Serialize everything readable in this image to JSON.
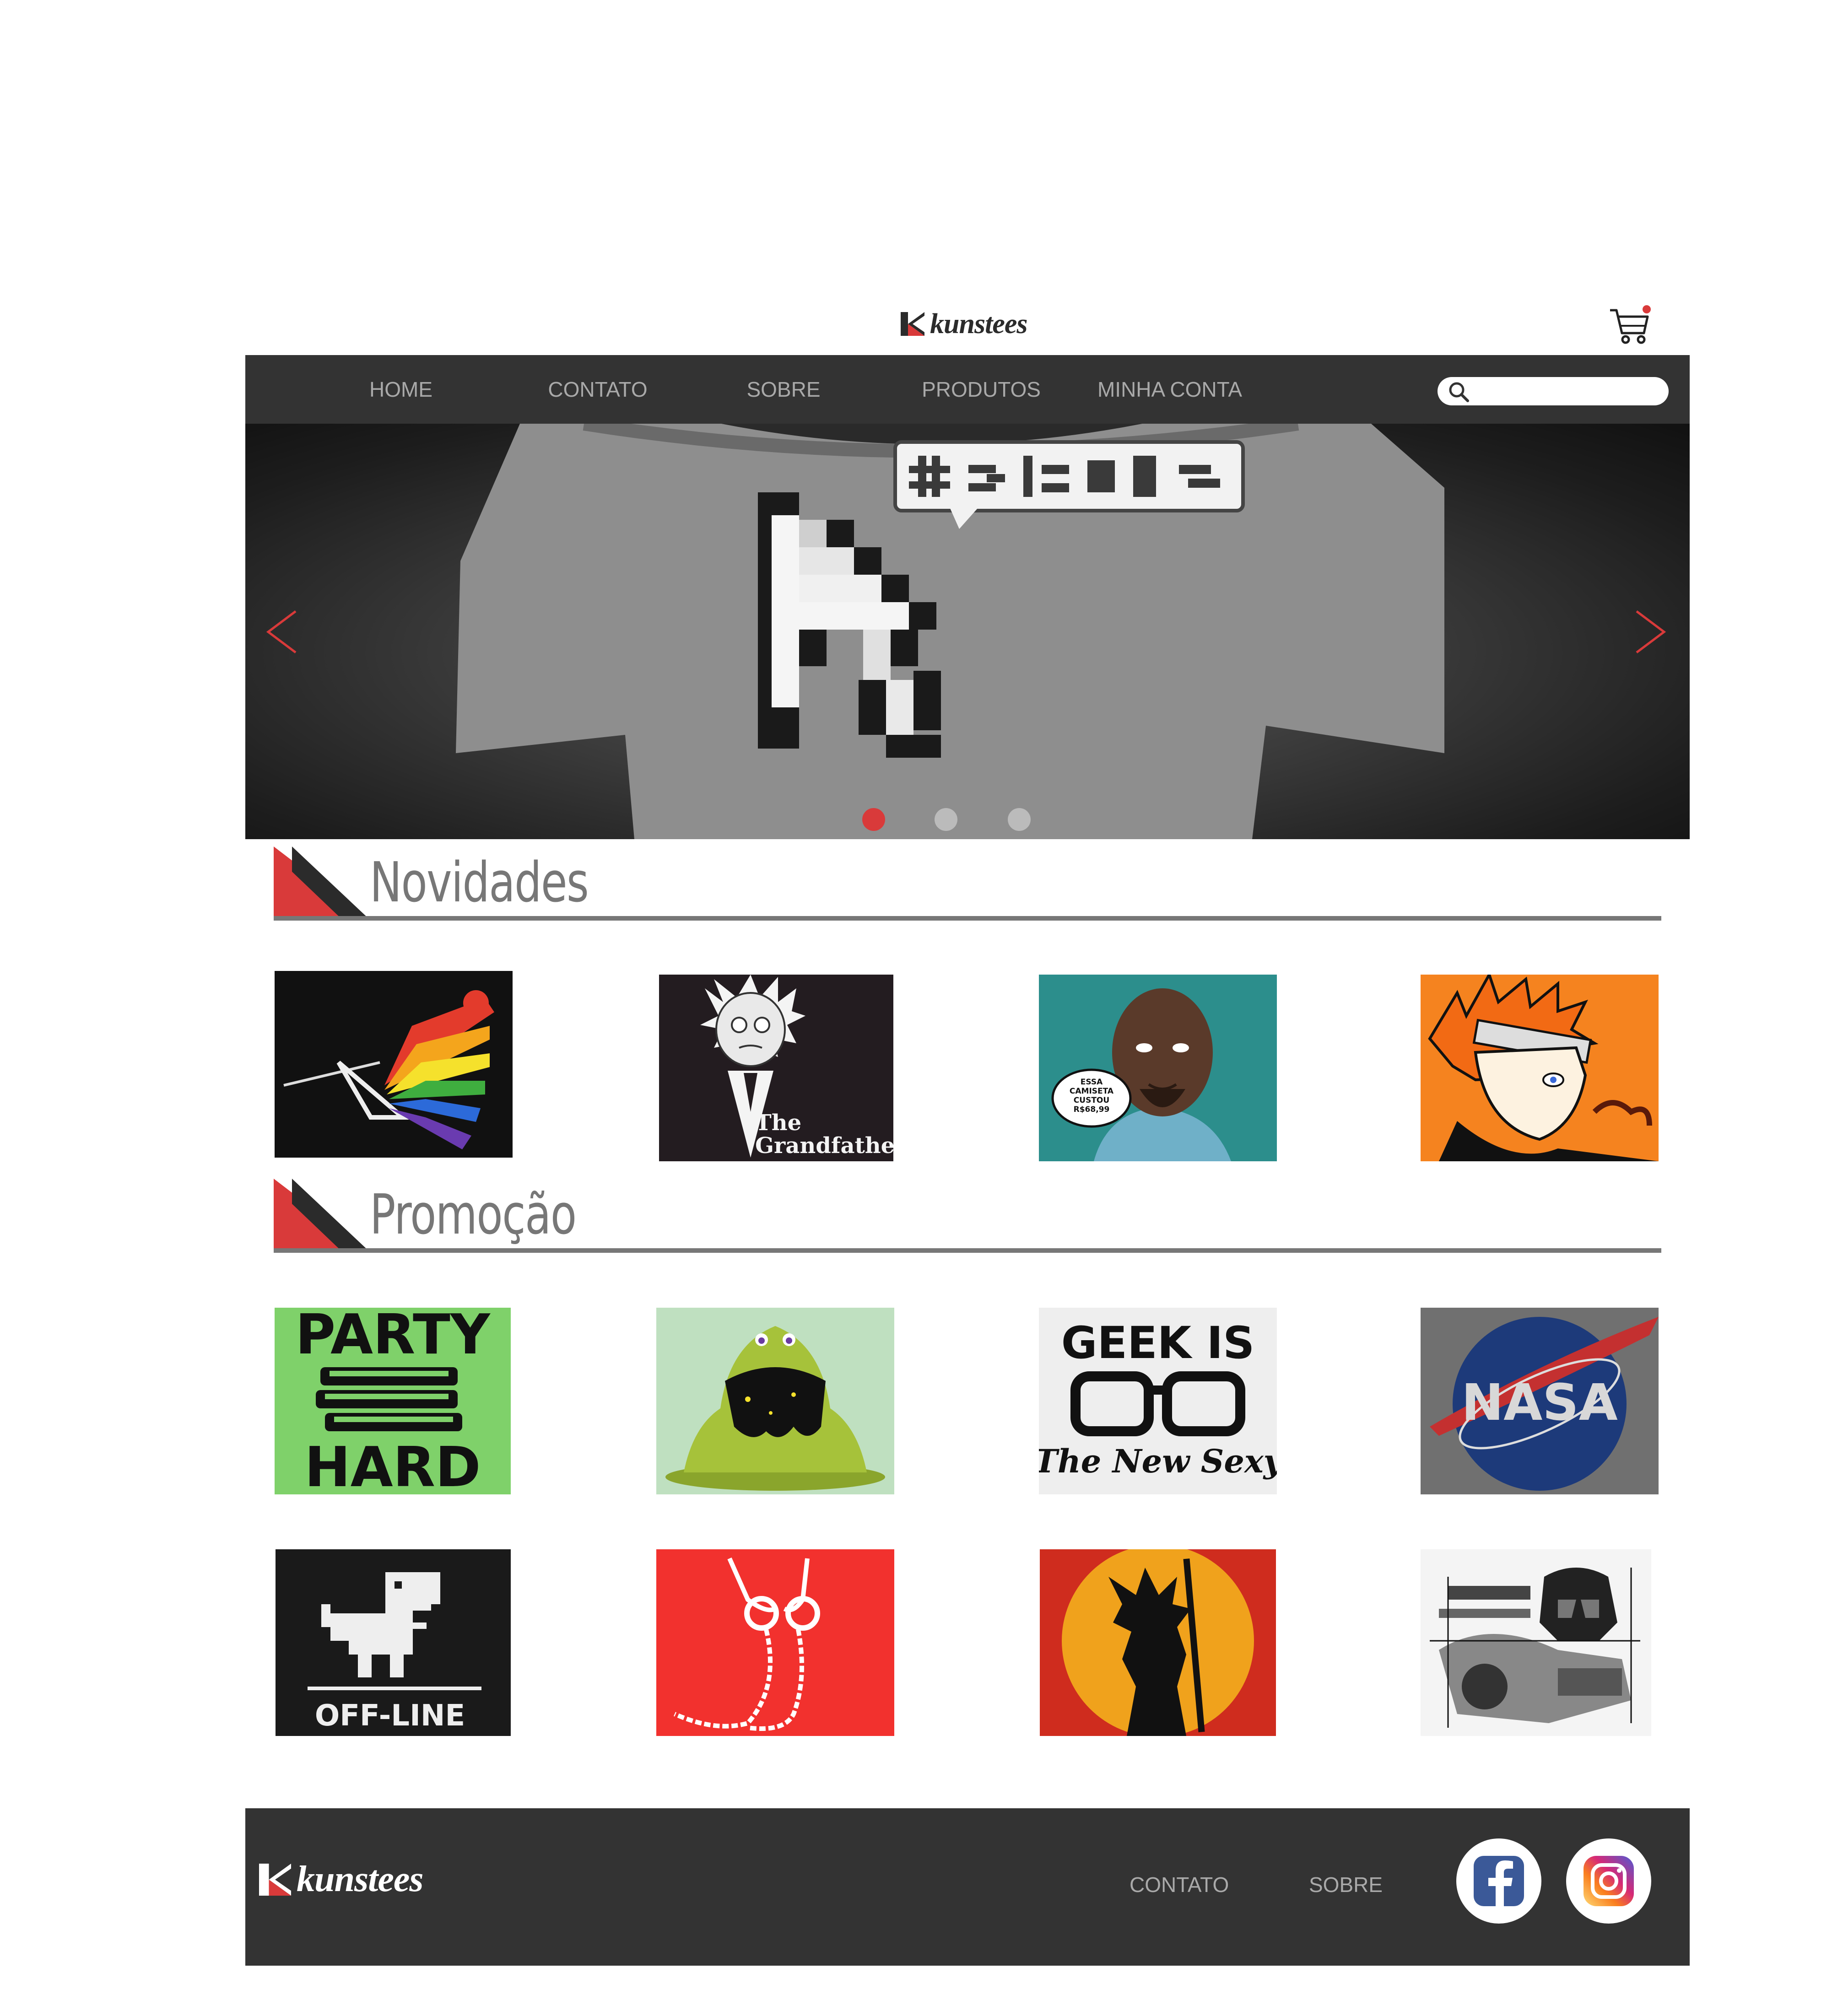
{
  "header": {
    "brand": "kunstees",
    "cart_icon": "shopping-cart-icon"
  },
  "nav": {
    "items": [
      "HOME",
      "CONTATO",
      "SOBRE",
      "PRODUTOS",
      "MINHA CONTA"
    ],
    "search_placeholder": "",
    "search_icon": "search-icon"
  },
  "carousel": {
    "slide_count": 3,
    "active_slide": 1,
    "prev_icon": "chevron-left-icon",
    "next_icon": "chevron-right-icon"
  },
  "sections": {
    "novidades": {
      "title": "Novidades",
      "products": [
        "prism-rainbow-shirt",
        "grandfather-shirt",
        "price-comic-shirt",
        "orange-ninja-shirt"
      ],
      "product_texts": {
        "grandfather": [
          "The",
          "Grandfather"
        ],
        "price_bubble": [
          "ESSA",
          "CAMISETA",
          "CUSTOU",
          "R$68,99"
        ]
      }
    },
    "promocao": {
      "title": "Promoção",
      "products": [
        "party-hard-shirt",
        "green-monster-shirt",
        "geek-is-shirt",
        "nasa-shirt",
        "offline-dino-shirt",
        "headphones-shirt",
        "sunset-silhouette-shirt",
        "space-helmet-shirt"
      ],
      "product_texts": {
        "party": [
          "PARTY",
          "HARD"
        ],
        "geek": [
          "GEEK IS",
          "The New Sexy"
        ],
        "nasa": "NASA",
        "offline": "OFF-LINE"
      }
    }
  },
  "footer": {
    "brand": "kunstees",
    "links": [
      "CONTATO",
      "SOBRE"
    ],
    "social": [
      "facebook-icon",
      "instagram-icon"
    ]
  },
  "colors": {
    "dark_bar": "#333333",
    "accent_red": "#d93a3a",
    "nav_text": "#a9a9a9",
    "heading_gray": "#777777",
    "dot_inactive": "#bbbbbb"
  }
}
